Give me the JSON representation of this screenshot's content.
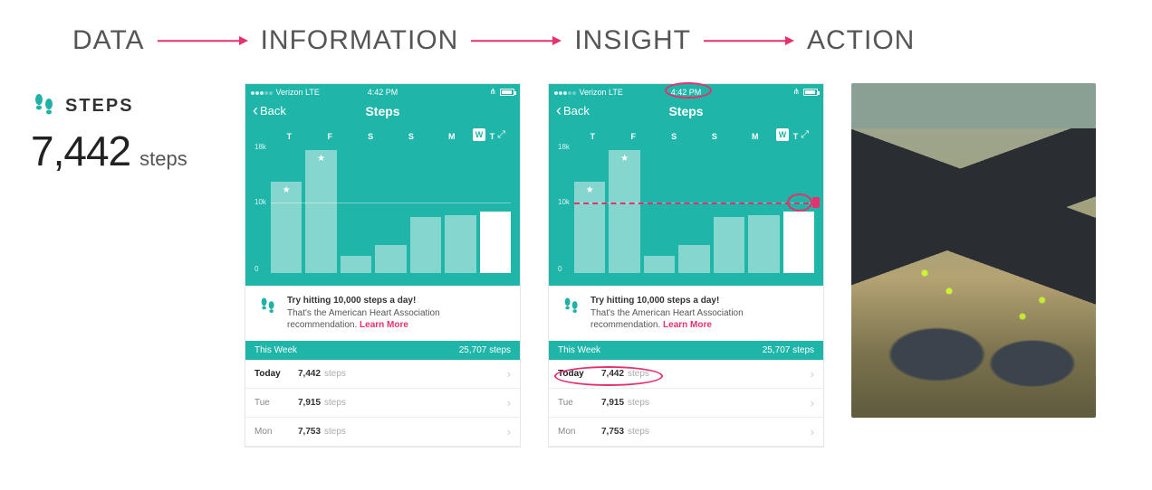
{
  "header": {
    "labels": [
      "DATA",
      "INFORMATION",
      "INSIGHT",
      "ACTION"
    ]
  },
  "data_panel": {
    "title": "STEPS",
    "value": "7,442",
    "unit": "steps"
  },
  "phone": {
    "status": {
      "carrier": "Verizon  LTE",
      "time": "4:42 PM"
    },
    "nav": {
      "back": "Back",
      "title": "Steps"
    },
    "day_labels": [
      "T",
      "F",
      "S",
      "S",
      "M",
      "T"
    ],
    "day_badge": "W",
    "y_top": "18k",
    "y_goal": "10k",
    "y_zero": "0",
    "tip": {
      "title": "Try hitting 10,000 steps a day!",
      "body": "That's the American Heart Association recommendation.",
      "link": "Learn More"
    },
    "week_header": {
      "label": "This Week",
      "total": "25,707 steps"
    },
    "list": [
      {
        "day": "Today",
        "val": "7,442",
        "unit": "steps",
        "today": true
      },
      {
        "day": "Tue",
        "val": "7,915",
        "unit": "steps",
        "today": false
      },
      {
        "day": "Mon",
        "val": "7,753",
        "unit": "steps",
        "today": false
      }
    ]
  },
  "chart_data": {
    "type": "bar",
    "title": "Steps",
    "categories": [
      "T",
      "F",
      "S",
      "S",
      "M",
      "T",
      "W"
    ],
    "values": [
      13000,
      17500,
      2500,
      4000,
      8000,
      8200,
      8800
    ],
    "goal": 10000,
    "ylim": [
      0,
      18000
    ],
    "ylabel": "steps",
    "xlabel": "",
    "starred": [
      0,
      1
    ],
    "current_index": 6
  },
  "colors": {
    "teal": "#1fb5a8",
    "pink": "#e6316c"
  }
}
